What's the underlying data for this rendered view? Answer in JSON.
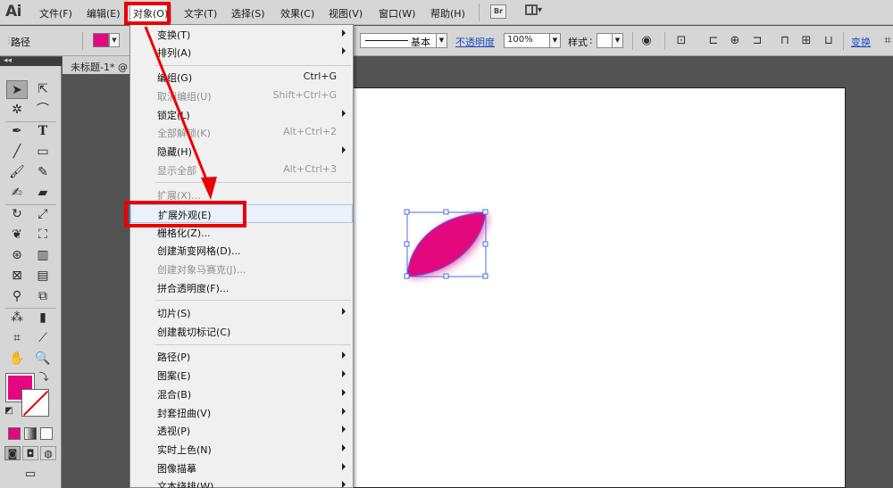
{
  "app": {
    "logo": "Ai"
  },
  "menubar": {
    "items": [
      {
        "label": "文件(F)"
      },
      {
        "label": "编辑(E)"
      },
      {
        "label": "对象(O)"
      },
      {
        "label": "文字(T)"
      },
      {
        "label": "选择(S)"
      },
      {
        "label": "效果(C)"
      },
      {
        "label": "视图(V)"
      },
      {
        "label": "窗口(W)"
      },
      {
        "label": "帮助(H)"
      }
    ],
    "bridge_label": "Br"
  },
  "controlbar": {
    "object_type": "路径",
    "fill_color": "#e4087f",
    "stroke_profile": "基本",
    "opacity_label": "不透明度",
    "opacity_value": "100%",
    "style_label": "样式",
    "transform_label": "变换"
  },
  "document": {
    "tab_title": "未标题-1* @"
  },
  "object_menu": {
    "items": [
      {
        "label": "变换(T)",
        "shortcut": "",
        "submenu": true,
        "disabled": false
      },
      {
        "label": "排列(A)",
        "shortcut": "",
        "submenu": true,
        "disabled": false
      },
      {
        "label": "编组(G)",
        "shortcut": "Ctrl+G",
        "submenu": false,
        "disabled": false
      },
      {
        "label": "取消编组(U)",
        "shortcut": "Shift+Ctrl+G",
        "submenu": false,
        "disabled": true
      },
      {
        "label": "锁定(L)",
        "shortcut": "",
        "submenu": true,
        "disabled": false
      },
      {
        "label": "全部解锁(K)",
        "shortcut": "Alt+Ctrl+2",
        "submenu": false,
        "disabled": true
      },
      {
        "label": "隐藏(H)",
        "shortcut": "",
        "submenu": true,
        "disabled": false
      },
      {
        "label": "显示全部",
        "shortcut": "Alt+Ctrl+3",
        "submenu": false,
        "disabled": true
      },
      {
        "label": "扩展(X)...",
        "shortcut": "",
        "submenu": false,
        "disabled": true
      },
      {
        "label": "扩展外观(E)",
        "shortcut": "",
        "submenu": false,
        "disabled": false,
        "highlighted": true
      },
      {
        "label": "栅格化(Z)...",
        "shortcut": "",
        "submenu": false,
        "disabled": false
      },
      {
        "label": "创建渐变网格(D)...",
        "shortcut": "",
        "submenu": false,
        "disabled": false
      },
      {
        "label": "创建对象马赛克(J)...",
        "shortcut": "",
        "submenu": false,
        "disabled": true
      },
      {
        "label": "拼合透明度(F)...",
        "shortcut": "",
        "submenu": false,
        "disabled": false
      },
      {
        "label": "切片(S)",
        "shortcut": "",
        "submenu": true,
        "disabled": false
      },
      {
        "label": "创建裁切标记(C)",
        "shortcut": "",
        "submenu": false,
        "disabled": false
      },
      {
        "label": "路径(P)",
        "shortcut": "",
        "submenu": true,
        "disabled": false
      },
      {
        "label": "图案(E)",
        "shortcut": "",
        "submenu": true,
        "disabled": false
      },
      {
        "label": "混合(B)",
        "shortcut": "",
        "submenu": true,
        "disabled": false
      },
      {
        "label": "封套扭曲(V)",
        "shortcut": "",
        "submenu": true,
        "disabled": false
      },
      {
        "label": "透视(P)",
        "shortcut": "",
        "submenu": true,
        "disabled": false
      },
      {
        "label": "实时上色(N)",
        "shortcut": "",
        "submenu": true,
        "disabled": false
      },
      {
        "label": "图像描摹",
        "shortcut": "",
        "submenu": true,
        "disabled": false
      },
      {
        "label": "文本绕排(W)",
        "shortcut": "",
        "submenu": true,
        "disabled": false
      }
    ]
  },
  "colors": {
    "accent_red": "#ea0000",
    "fill_magenta": "#e4087f",
    "selection_blue": "#4a6fe0"
  }
}
